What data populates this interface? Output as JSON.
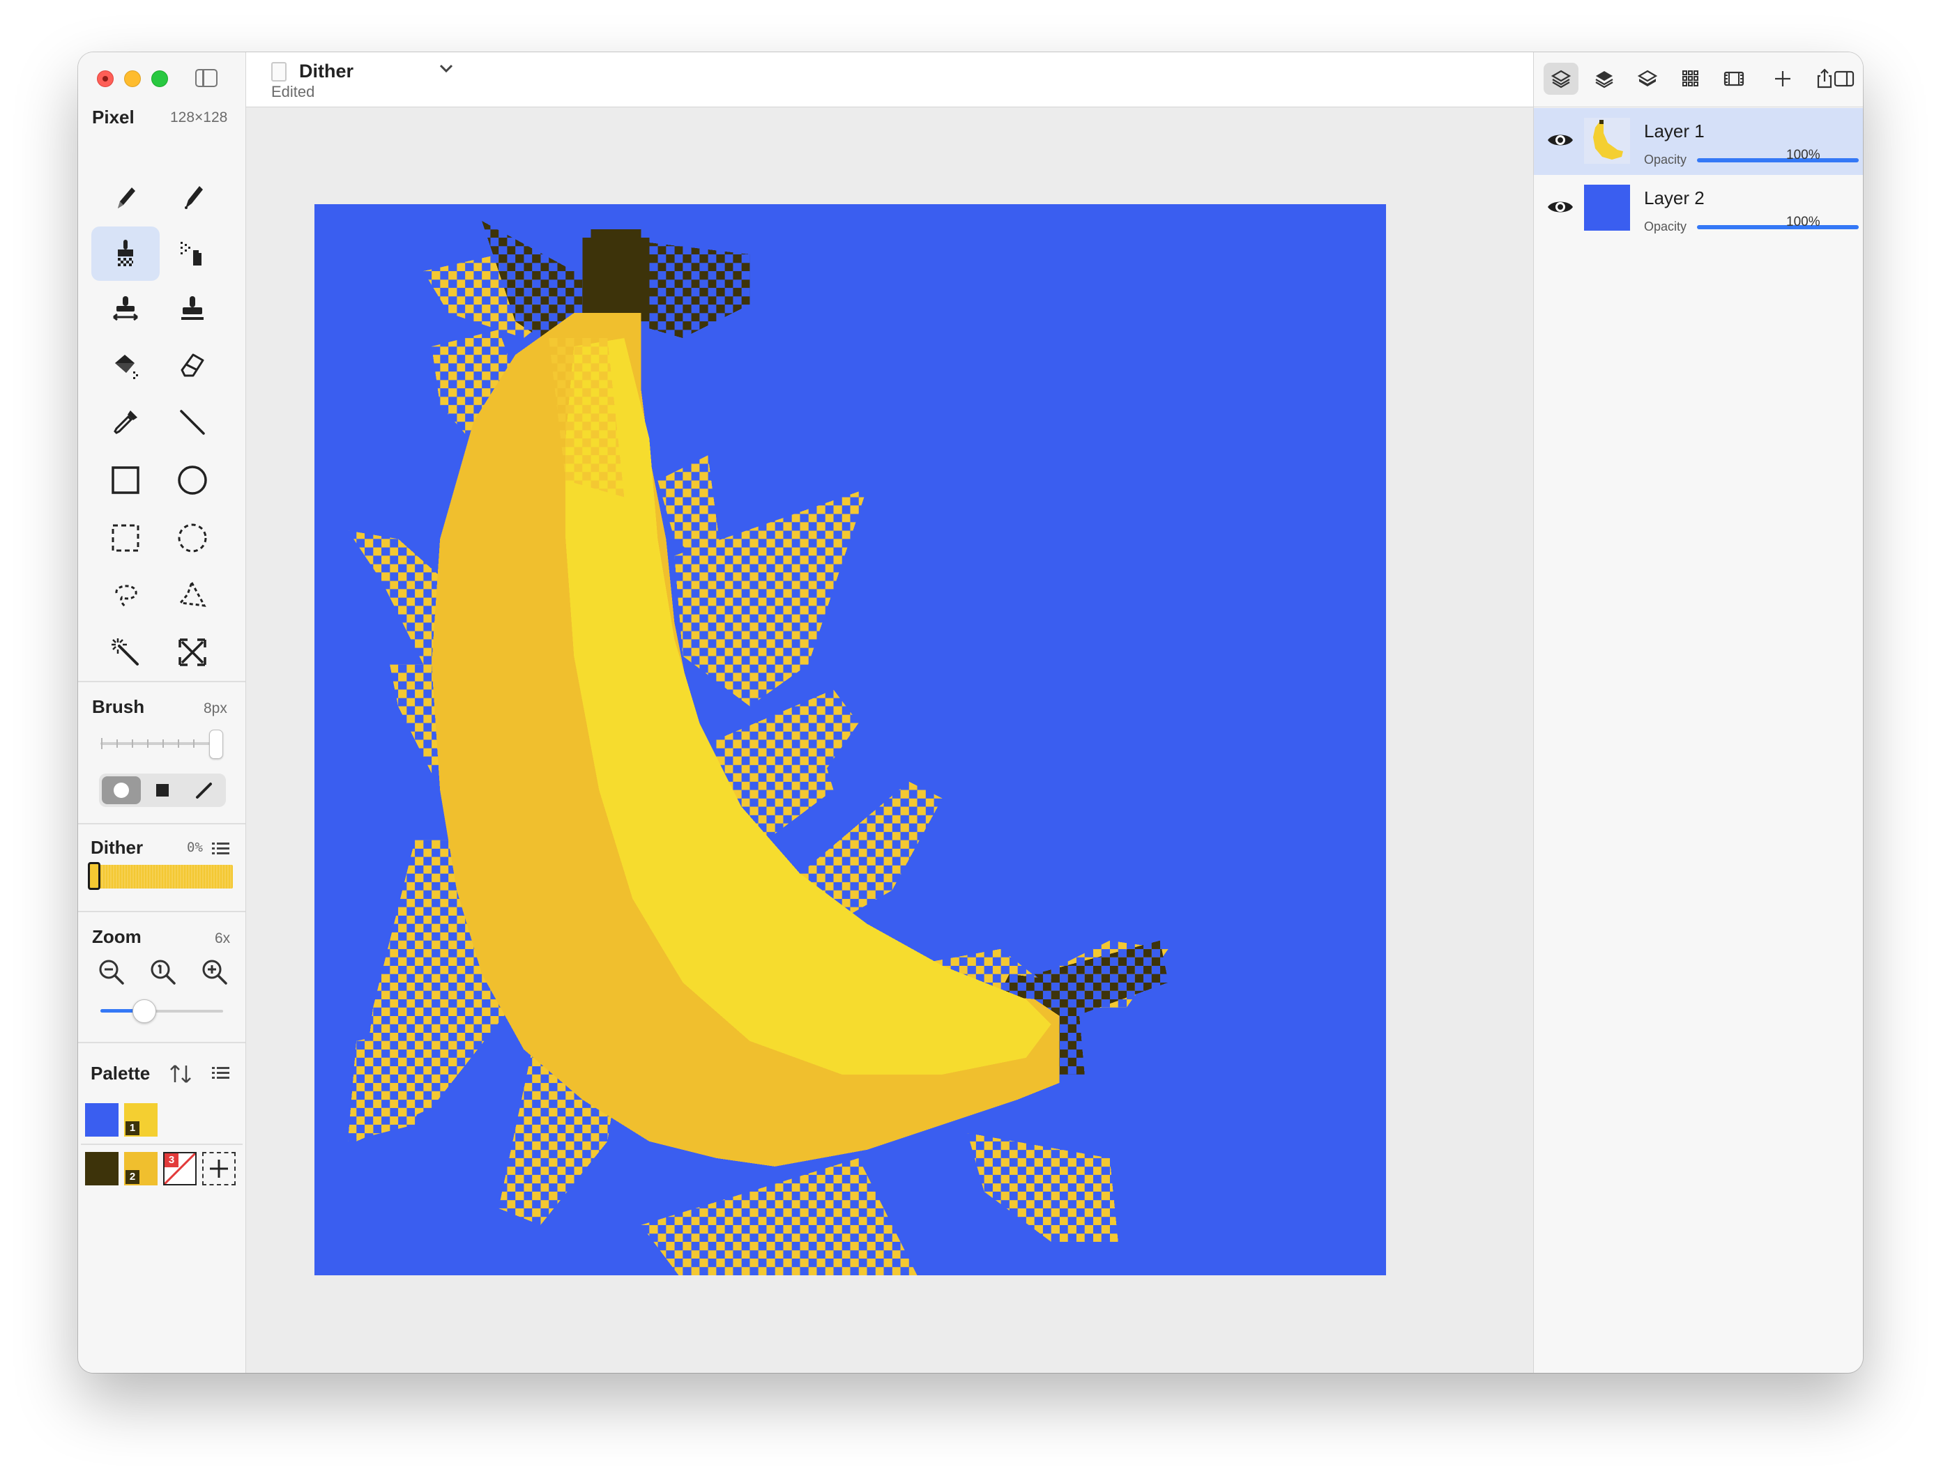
{
  "app": {
    "document_title": "Dither",
    "document_status": "Edited"
  },
  "sidebar": {
    "mode_title": "Pixel",
    "canvas_size": "128×128",
    "tools": [
      {
        "icon": "pencil-icon",
        "active": false
      },
      {
        "icon": "pen-icon",
        "active": false
      },
      {
        "icon": "dither-brush-icon",
        "active": true
      },
      {
        "icon": "spray-icon",
        "active": false
      },
      {
        "icon": "mirror-stamp-icon",
        "active": false
      },
      {
        "icon": "stamp-icon",
        "active": false
      },
      {
        "icon": "paint-bucket-icon",
        "active": false
      },
      {
        "icon": "eraser-icon",
        "active": false
      },
      {
        "icon": "eyedropper-icon",
        "active": false
      },
      {
        "icon": "line-icon",
        "active": false
      },
      {
        "icon": "rectangle-icon",
        "active": false
      },
      {
        "icon": "ellipse-icon",
        "active": false
      },
      {
        "icon": "rect-select-icon",
        "active": false
      },
      {
        "icon": "ellipse-select-icon",
        "active": false
      },
      {
        "icon": "lasso-icon",
        "active": false
      },
      {
        "icon": "polygon-lasso-icon",
        "active": false
      },
      {
        "icon": "magic-wand-icon",
        "active": false
      },
      {
        "icon": "transform-icon",
        "active": false
      }
    ],
    "brush": {
      "title": "Brush",
      "value": "8px",
      "slider_fraction": 1.0,
      "shapes": [
        "circle",
        "square",
        "line"
      ],
      "selected_shape": "circle"
    },
    "dither": {
      "title": "Dither",
      "value": "0%",
      "color": "#f4c832"
    },
    "zoom": {
      "title": "Zoom",
      "value": "6x",
      "slider_fraction": 0.35
    },
    "palette": {
      "title": "Palette",
      "colors": [
        {
          "hex": "#3a5ef0",
          "badge": ""
        },
        {
          "hex": "#f4cf31",
          "badge": "1"
        },
        {
          "hex": "#3d330a",
          "badge": ""
        },
        {
          "hex": "#f0bf2e",
          "badge": "2"
        },
        {
          "hex": "transparent",
          "badge": "3"
        }
      ]
    }
  },
  "layers_panel": {
    "toolbar_icons": [
      "layers-icon",
      "layers-above-icon",
      "layers-below-icon",
      "grid-icon",
      "filmstrip-icon",
      "add-icon",
      "share-icon",
      "panel-toggle-icon"
    ],
    "layers": [
      {
        "name": "Layer 1",
        "opacity_label": "Opacity",
        "opacity_value": "100%",
        "opacity": 1.0,
        "visible": true,
        "selected": true,
        "thumb_color": "#f4cf31"
      },
      {
        "name": "Layer 2",
        "opacity_label": "Opacity",
        "opacity_value": "100%",
        "opacity": 1.0,
        "visible": true,
        "selected": false,
        "thumb_color": "#3a5ef0"
      }
    ]
  },
  "colors": {
    "accent": "#3478f6",
    "canvas_background": "#3a5ef0",
    "banana_light": "#f6dc2e",
    "banana_dark": "#f0bf2e",
    "stem": "#3d330a"
  }
}
